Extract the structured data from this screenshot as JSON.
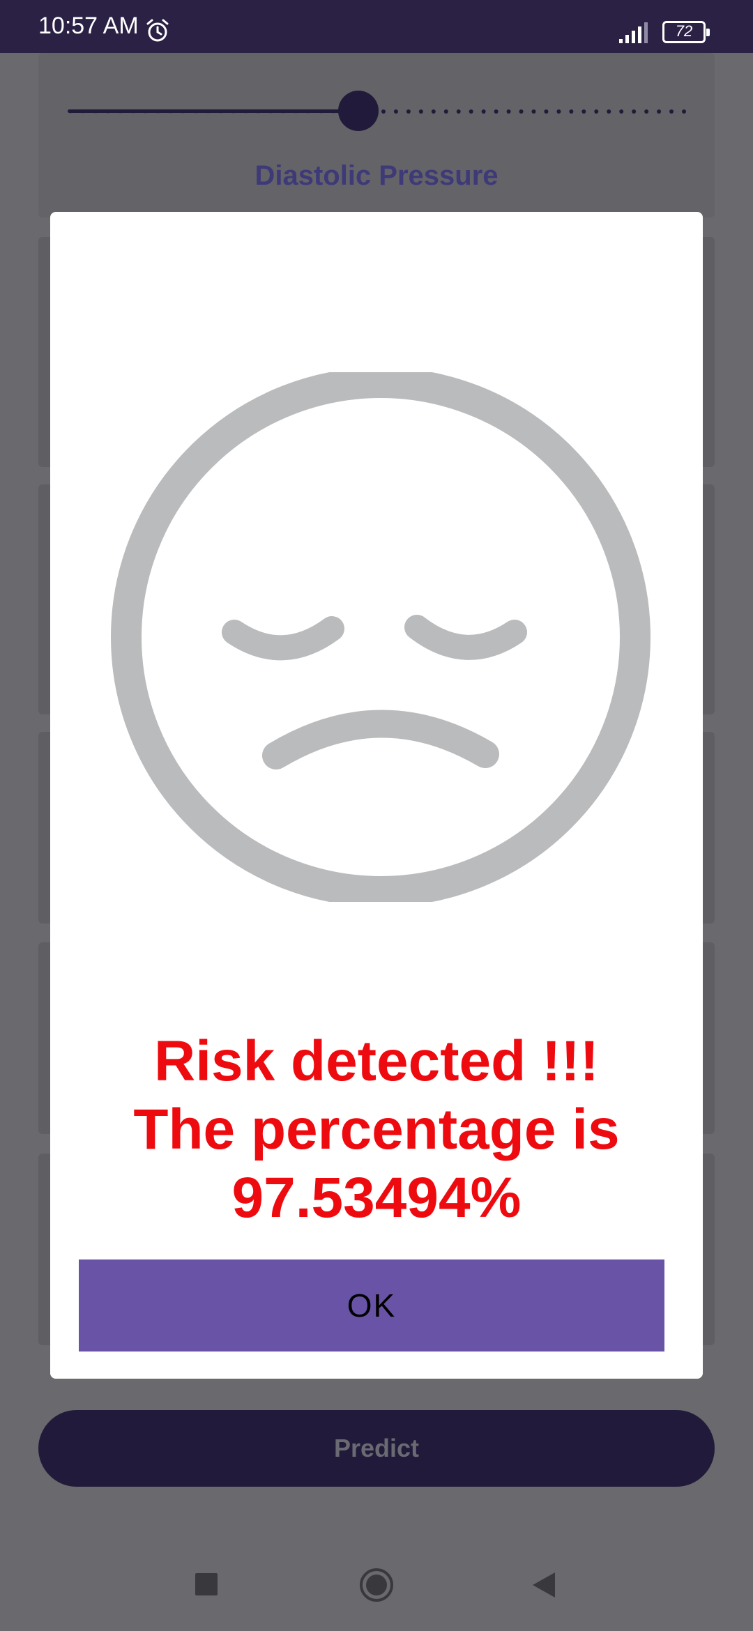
{
  "status_bar": {
    "time": "10:57 AM",
    "battery": "72",
    "alarm_icon": "alarm-clock-icon",
    "signal_icon": "cellular-signal-icon"
  },
  "background": {
    "slider": {
      "label": "Diastolic Pressure",
      "value_fraction": 0.47
    },
    "predict_label": "Predict"
  },
  "dialog": {
    "icon": "sad-face-icon",
    "message_lines": [
      "Risk detected !!!",
      "The percentage is",
      "97.53494%"
    ],
    "ok_label": "OK"
  },
  "nav_bar": {
    "recents_icon": "square-recents-icon",
    "home_icon": "circle-home-icon",
    "back_icon": "triangle-back-icon"
  },
  "colors": {
    "status_bar": "#2a2145",
    "scrim_background": "#6a696d",
    "primary_dark": "#211a3a",
    "label_blue": "#3e3a78",
    "dialog_background": "#ffffff",
    "face_gray": "#babbbd",
    "risk_red": "#ee0b10",
    "ok_button": "#6853a6"
  }
}
